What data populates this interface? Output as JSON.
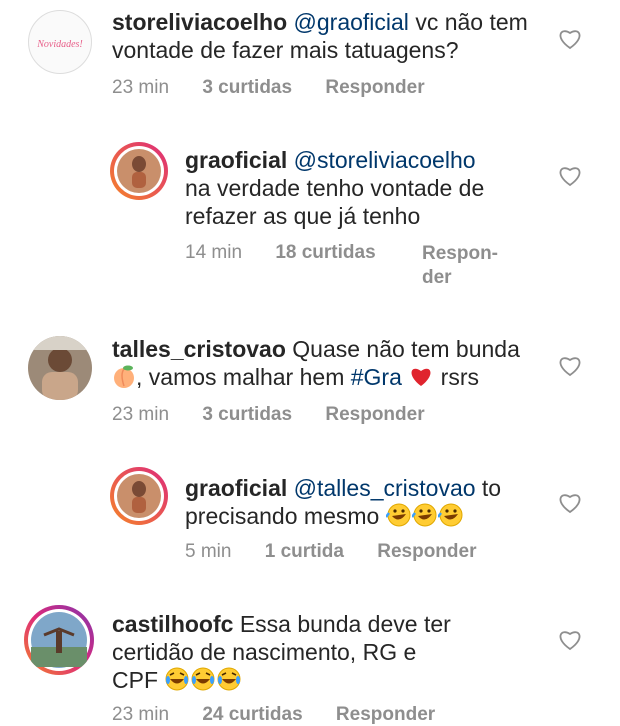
{
  "comments": [
    {
      "username": "storeliviacoelho",
      "mention": "@graoficial",
      "text_line1": "vc não tem",
      "text_line2": "vontade de fazer mais tatuagens?",
      "avatar_label": "Novidades!",
      "time": "23 min",
      "likes": "3 curtidas",
      "reply": "Responder"
    },
    {
      "username": "graoficial",
      "mention": "@storeliviacoelho",
      "text_line1": "na verdade tenho vontade de",
      "text_line2": "refazer as que já tenho",
      "time": "14 min",
      "likes": "18 curtidas",
      "reply_line1": "Respon-",
      "reply_line2": "der"
    },
    {
      "username": "talles_cristovao",
      "text_line1": "Quase não tem bunda",
      "text_line2a": ", vamos malhar hem",
      "hashtag": "#Gra",
      "text_line2b": "rsrs",
      "time": "23 min",
      "likes": "3 curtidas",
      "reply": "Responder"
    },
    {
      "username": "graoficial",
      "mention": "@talles_cristovao",
      "text_line1": "to",
      "text_line2": "precisando mesmo",
      "time": "5 min",
      "likes": "1 curtida",
      "reply": "Responder"
    },
    {
      "username": "castilhoofc",
      "text_line1": "Essa bunda deve ter",
      "text_line2": "certidão de nascimento, RG e",
      "text_line3": "CPF",
      "time": "23 min",
      "likes": "24 curtidas",
      "reply": "Responder"
    }
  ],
  "colors": {
    "mention": "#00376b",
    "meta": "#8e8e8e",
    "text": "#262626",
    "story_ring_a": "#f58529",
    "story_ring_b": "#dd2a7b"
  },
  "icons": [
    "heart-outline-icon",
    "peach-emoji-icon",
    "red-heart-emoji-icon",
    "rofl-emoji-icon",
    "joy-emoji-icon"
  ]
}
